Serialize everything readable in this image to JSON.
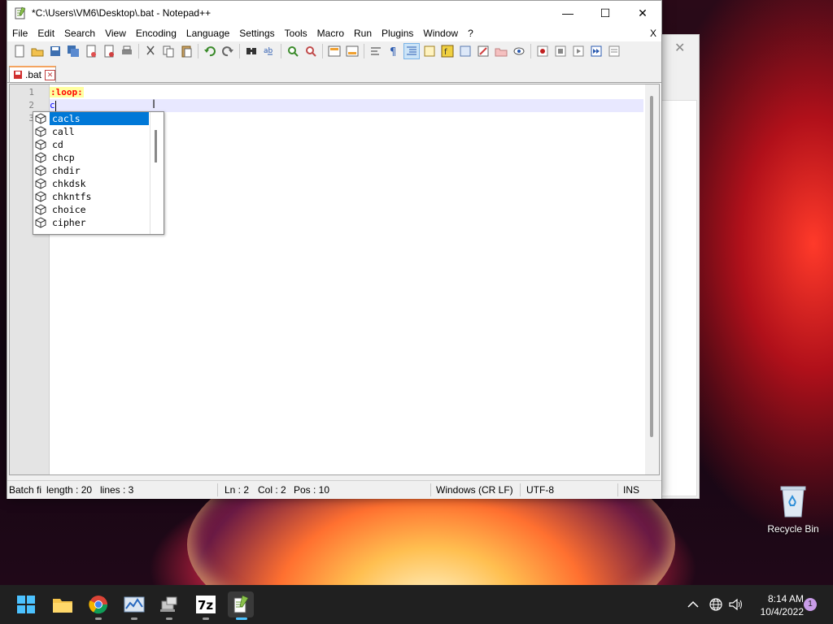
{
  "window": {
    "title": "*C:\\Users\\VM6\\Desktop\\.bat - Notepad++",
    "minimize_label": "—",
    "maximize_label": "☐",
    "close_label": "✕"
  },
  "menu": {
    "items": [
      "File",
      "Edit",
      "Search",
      "View",
      "Encoding",
      "Language",
      "Settings",
      "Tools",
      "Macro",
      "Run",
      "Plugins",
      "Window",
      "?"
    ],
    "close_label": "X"
  },
  "tab": {
    "label": ".bat"
  },
  "editor": {
    "lines": [
      {
        "number": "1",
        "text": ":loop:"
      },
      {
        "number": "2",
        "text": "c"
      },
      {
        "number": "3",
        "text": ""
      }
    ]
  },
  "autocomplete": {
    "items": [
      "cacls",
      "call",
      "cd",
      "chcp",
      "chdir",
      "chkdsk",
      "chkntfs",
      "choice",
      "cipher"
    ],
    "selected_index": 0
  },
  "status": {
    "language": "Batch fi",
    "length": "length : 20",
    "lines": "lines : 3",
    "ln": "Ln : 2",
    "col": "Col : 2",
    "pos": "Pos : 10",
    "eol": "Windows (CR LF)",
    "encoding": "UTF-8",
    "mode": "INS"
  },
  "desktop": {
    "recycle_bin_label": "Recycle Bin",
    "background_window_close": "✕"
  },
  "taskbar": {
    "apps": [
      "start-icon",
      "file-explorer-icon",
      "chrome-icon",
      "task-manager-icon",
      "network-app-icon",
      "7zip-icon",
      "notepadpp-icon"
    ],
    "time": "8:14 AM",
    "date": "10/4/2022",
    "notification_count": "1"
  },
  "colors": {
    "selection": "#0078d7",
    "label_bg": "#ffffa0",
    "label_fg": "#ff0000",
    "current_line": "#e8e8ff"
  }
}
